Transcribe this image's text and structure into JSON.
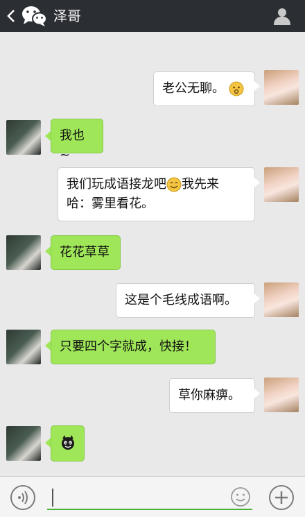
{
  "header": {
    "back_icon": "chevron-left-icon",
    "app_icon": "wechat-icon",
    "title": "泽哥",
    "profile_icon": "person-icon"
  },
  "messages": [
    {
      "sender": "me",
      "text": "老公无聊。",
      "emoji": "sad-face-emoji"
    },
    {
      "sender": "friend",
      "text": "我也~"
    },
    {
      "sender": "me",
      "text_line1": "我们玩成语接龙吧",
      "emoji": "smile-emoji",
      "text_line1_after": "我先来",
      "text_line2": "哈：雾里看花。"
    },
    {
      "sender": "friend",
      "text": "花花草草"
    },
    {
      "sender": "me",
      "text": "这是个毛线成语啊。"
    },
    {
      "sender": "friend",
      "text": "只要四个字就成，快接！"
    },
    {
      "sender": "me",
      "text": "草你麻痹。"
    },
    {
      "sender": "friend",
      "emoji": "devil-emoji"
    }
  ],
  "input_bar": {
    "voice_icon": "voice-icon",
    "text_value": "",
    "emoji_icon": "smiley-icon",
    "plus_icon": "plus-icon"
  },
  "colors": {
    "header_bg": "#2b2e33",
    "chat_bg": "#e9e9e9",
    "bubble_green": "#9fe658",
    "bubble_white": "#ffffff",
    "input_accent": "#49b233"
  }
}
